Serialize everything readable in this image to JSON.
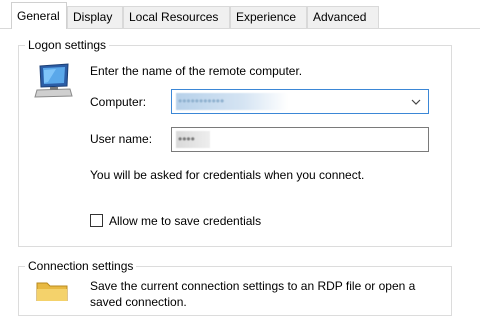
{
  "tabs": [
    {
      "label": "General",
      "active": true
    },
    {
      "label": "Display"
    },
    {
      "label": "Local Resources"
    },
    {
      "label": "Experience"
    },
    {
      "label": "Advanced"
    }
  ],
  "logon": {
    "title": "Logon settings",
    "icon": "computer-monitor-icon",
    "prompt": "Enter the name of the remote computer.",
    "computer_label": "Computer:",
    "computer_value": "•••••••••••",
    "user_label": "User name:",
    "user_value": "••••",
    "credentials_note": "You will be asked for credentials when you connect.",
    "save_credentials_label": "Allow me to save credentials",
    "save_credentials_checked": false
  },
  "connection": {
    "title": "Connection settings",
    "icon": "folder-icon",
    "description_line1": "Save the current connection settings to an RDP file or open a",
    "description_line2": "saved connection."
  },
  "colors": {
    "accent": "#3b87d6",
    "border": "#dcdcdc"
  }
}
